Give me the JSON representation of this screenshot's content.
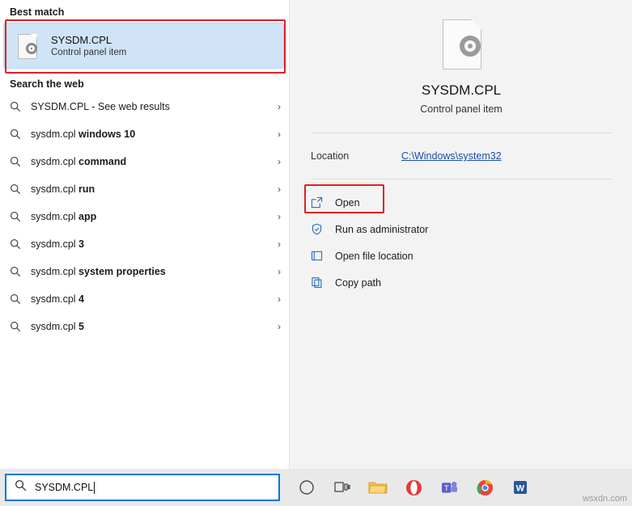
{
  "left": {
    "best_match_header": "Best match",
    "best_match": {
      "title": "SYSDM.CPL",
      "subtitle": "Control panel item",
      "icon": "control-panel-file-icon"
    },
    "web_header": "Search the web",
    "web_results": [
      {
        "prefix": "SYSDM.CPL",
        "suffix": " - See web results",
        "bold": ""
      },
      {
        "prefix": "sysdm.cpl ",
        "bold": "windows 10",
        "suffix": ""
      },
      {
        "prefix": "sysdm.cpl ",
        "bold": "command",
        "suffix": ""
      },
      {
        "prefix": "sysdm.cpl ",
        "bold": "run",
        "suffix": ""
      },
      {
        "prefix": "sysdm.cpl ",
        "bold": "app",
        "suffix": ""
      },
      {
        "prefix": "sysdm.cpl ",
        "bold": "3",
        "suffix": ""
      },
      {
        "prefix": "sysdm.cpl ",
        "bold": "system properties",
        "suffix": ""
      },
      {
        "prefix": "sysdm.cpl ",
        "bold": "4",
        "suffix": ""
      },
      {
        "prefix": "sysdm.cpl ",
        "bold": "5",
        "suffix": ""
      }
    ]
  },
  "preview": {
    "title": "SYSDM.CPL",
    "subtitle": "Control panel item",
    "location_label": "Location",
    "location_value": "C:\\Windows\\system32",
    "actions": [
      {
        "label": "Open",
        "icon": "open-icon",
        "highlighted": true
      },
      {
        "label": "Run as administrator",
        "icon": "shield-icon",
        "highlighted": false
      },
      {
        "label": "Open file location",
        "icon": "folder-open-icon",
        "highlighted": false
      },
      {
        "label": "Copy path",
        "icon": "copy-icon",
        "highlighted": false
      }
    ]
  },
  "taskbar": {
    "search_value": "SYSDM.CPL",
    "search_icon": "search-icon",
    "items": [
      {
        "name": "cortana-icon"
      },
      {
        "name": "task-view-icon"
      },
      {
        "name": "file-explorer-icon"
      },
      {
        "name": "opera-icon"
      },
      {
        "name": "microsoft-teams-icon"
      },
      {
        "name": "google-chrome-icon"
      },
      {
        "name": "microsoft-word-icon"
      }
    ]
  },
  "watermark": "wsxdn.com",
  "colors": {
    "highlight_box": "#e02020",
    "selection": "#cfe4f7",
    "link": "#1b4ea8",
    "search_border": "#0078d7"
  }
}
